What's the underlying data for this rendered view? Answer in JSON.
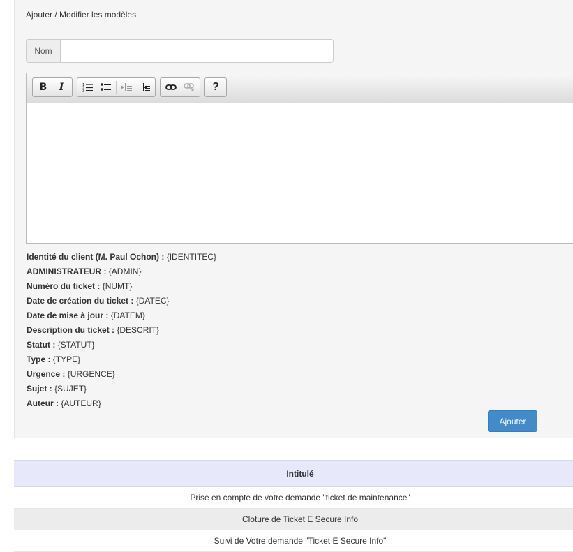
{
  "header": {
    "title": "Ajouter / Modifier les modèles"
  },
  "name_field": {
    "label": "Nom",
    "value": "",
    "placeholder": ""
  },
  "toolbar": {
    "bold": "B",
    "italic": "I",
    "ordered_list_icon": "ordered-list-icon",
    "bullet_list_icon": "bullet-list-icon",
    "outdent_icon": "outdent-icon",
    "indent_icon": "indent-icon",
    "link_icon": "link-icon",
    "unlink_icon": "unlink-icon",
    "help": "?"
  },
  "variables": [
    {
      "label": "Identité du client (M. Paul Ochon) :",
      "token": "{IDENTITEC}"
    },
    {
      "label": "ADMINISTRATEUR :",
      "token": "{ADMIN}"
    },
    {
      "label": "Numéro du ticket :",
      "token": "{NUMT}"
    },
    {
      "label": "Date de création du ticket :",
      "token": "{DATEC}"
    },
    {
      "label": "Date de mise à jour :",
      "token": "{DATEM}"
    },
    {
      "label": "Description du ticket :",
      "token": "{DESCRIT}"
    },
    {
      "label": "Statut :",
      "token": "{STATUT}"
    },
    {
      "label": "Type :",
      "token": "{TYPE}"
    },
    {
      "label": "Urgence :",
      "token": "{URGENCE}"
    },
    {
      "label": "Sujet :",
      "token": "{SUJET}"
    },
    {
      "label": "Auteur :",
      "token": "{AUTEUR}"
    }
  ],
  "add_button": {
    "label": "Ajouter"
  },
  "table": {
    "header": "Intitulé",
    "rows": [
      "Prise en compte de votre demande \"ticket de maintenance\"",
      "Cloture de Ticket E Secure Info",
      "Suivi de Votre demande \"Ticket E Secure Info\""
    ]
  },
  "colors": {
    "primary_button": "#428bca",
    "table_header": "#e8e8fb",
    "panel_background": "#f5f5f5"
  }
}
